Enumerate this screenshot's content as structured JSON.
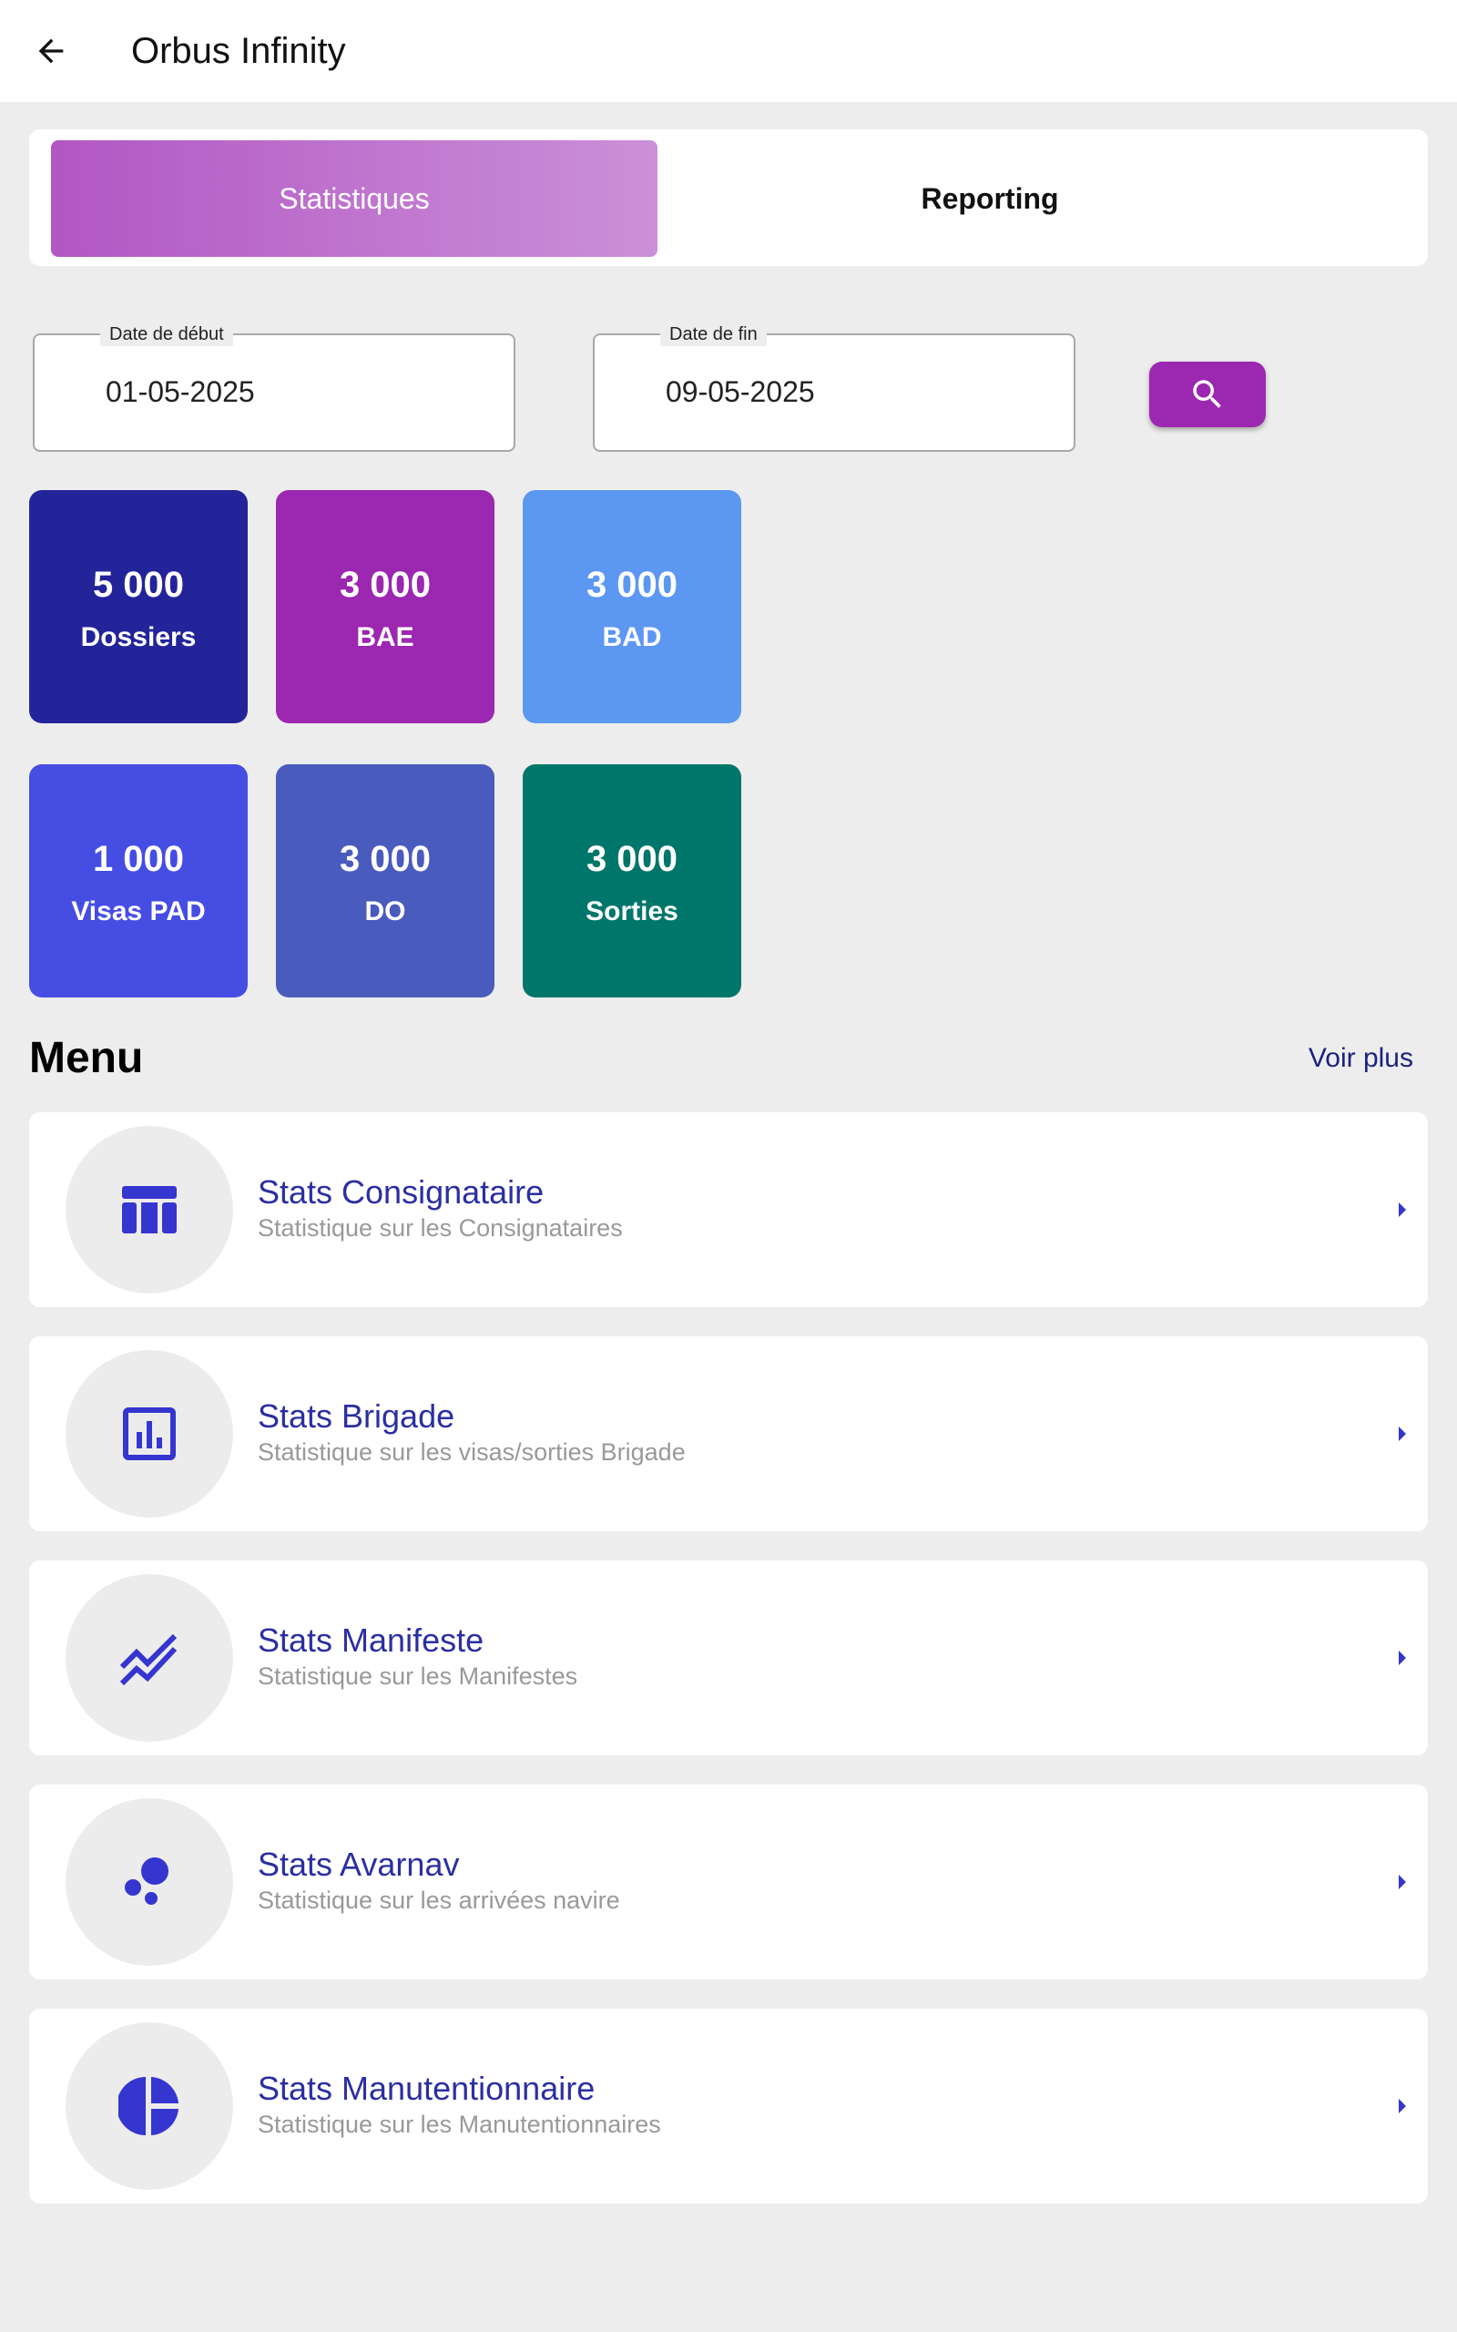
{
  "appbar": {
    "title": "Orbus Infinity",
    "back_icon": "arrow-left-icon"
  },
  "tabs": [
    {
      "label": "Statistiques",
      "active": true
    },
    {
      "label": "Reporting",
      "active": false
    }
  ],
  "filters": {
    "start": {
      "label": "Date de début",
      "value": "01-05-2025"
    },
    "end": {
      "label": "Date de fin",
      "value": "09-05-2025"
    },
    "search_icon": "search-icon"
  },
  "stats": [
    {
      "value": "5 000",
      "label": "Dossiers",
      "color": "#23249a"
    },
    {
      "value": "3 000",
      "label": "BAE",
      "color": "#9c27b0"
    },
    {
      "value": "3 000",
      "label": "BAD",
      "color": "#5c97f2"
    },
    {
      "value": "1 000",
      "label": "Visas PAD",
      "color": "#464de3"
    },
    {
      "value": "3 000",
      "label": "DO",
      "color": "#4a5bbe"
    },
    {
      "value": "3 000",
      "label": "Sorties",
      "color": "#00766a"
    }
  ],
  "menu": {
    "title": "Menu",
    "see_more": "Voir plus",
    "items": [
      {
        "title": "Stats Consignataire",
        "subtitle": "Statistique sur les Consignataires",
        "icon": "table-icon"
      },
      {
        "title": "Stats Brigade",
        "subtitle": "Statistique sur les visas/sorties Brigade",
        "icon": "bar-chart-icon"
      },
      {
        "title": "Stats Manifeste",
        "subtitle": "Statistique sur les Manifestes",
        "icon": "multiline-chart-icon"
      },
      {
        "title": "Stats Avarnav",
        "subtitle": "Statistique sur les arrivées navire",
        "icon": "bubble-chart-icon"
      },
      {
        "title": "Stats Manutentionnaire",
        "subtitle": "Statistique sur les Manutentionnaires",
        "icon": "pie-chart-icon"
      }
    ]
  },
  "colors": {
    "accent": "#9c27b0",
    "menu_text": "#2b2fa0",
    "menu_icon": "#3535d0",
    "link": "#1a237e",
    "background": "#ededed"
  }
}
